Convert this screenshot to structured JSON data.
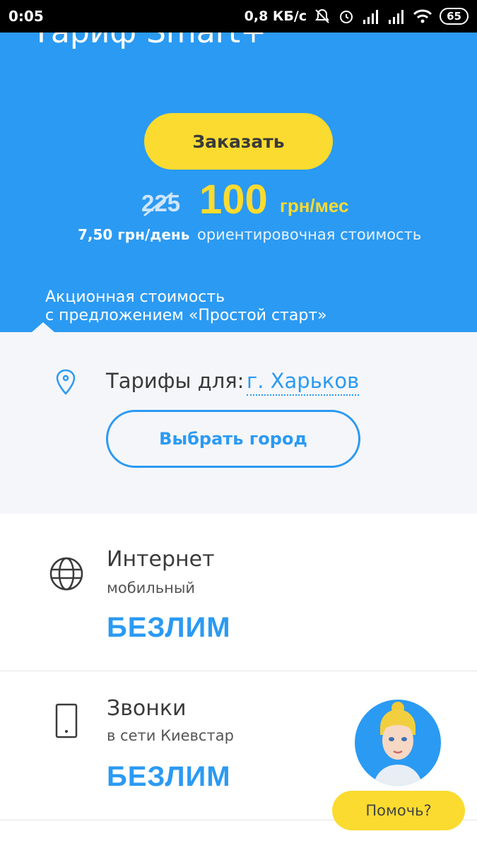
{
  "status_bar": {
    "time": "0:05",
    "network_speed": "0,8 КБ/с",
    "battery": "65"
  },
  "hero": {
    "title": "Тариф Smart+",
    "order_label": "Заказать",
    "old_price": "225",
    "new_price": "100",
    "price_unit": "грн/мес",
    "per_day": "7,50 грн/день",
    "approx_note": "ориентировочная стоимость",
    "promo_line1": "Акционная стоимость",
    "promo_line2": "с предложением «Простой старт»"
  },
  "city": {
    "label": "Тарифы для:",
    "name": "г. Харьков",
    "choose_label": "Выбрать город"
  },
  "features": [
    {
      "title": "Интернет",
      "subtitle": "мобильный",
      "value": "БЕЗЛИМ",
      "icon": "globe-icon"
    },
    {
      "title": "Звонки",
      "subtitle": "в сети Киевстар",
      "value": "БЕЗЛИМ",
      "icon": "phone-icon"
    }
  ],
  "assistant": {
    "help_label": "Помочь?"
  },
  "colors": {
    "primary_blue": "#2b9af3",
    "accent_yellow": "#fbdb2f",
    "section_gray": "#f5f6f9"
  }
}
